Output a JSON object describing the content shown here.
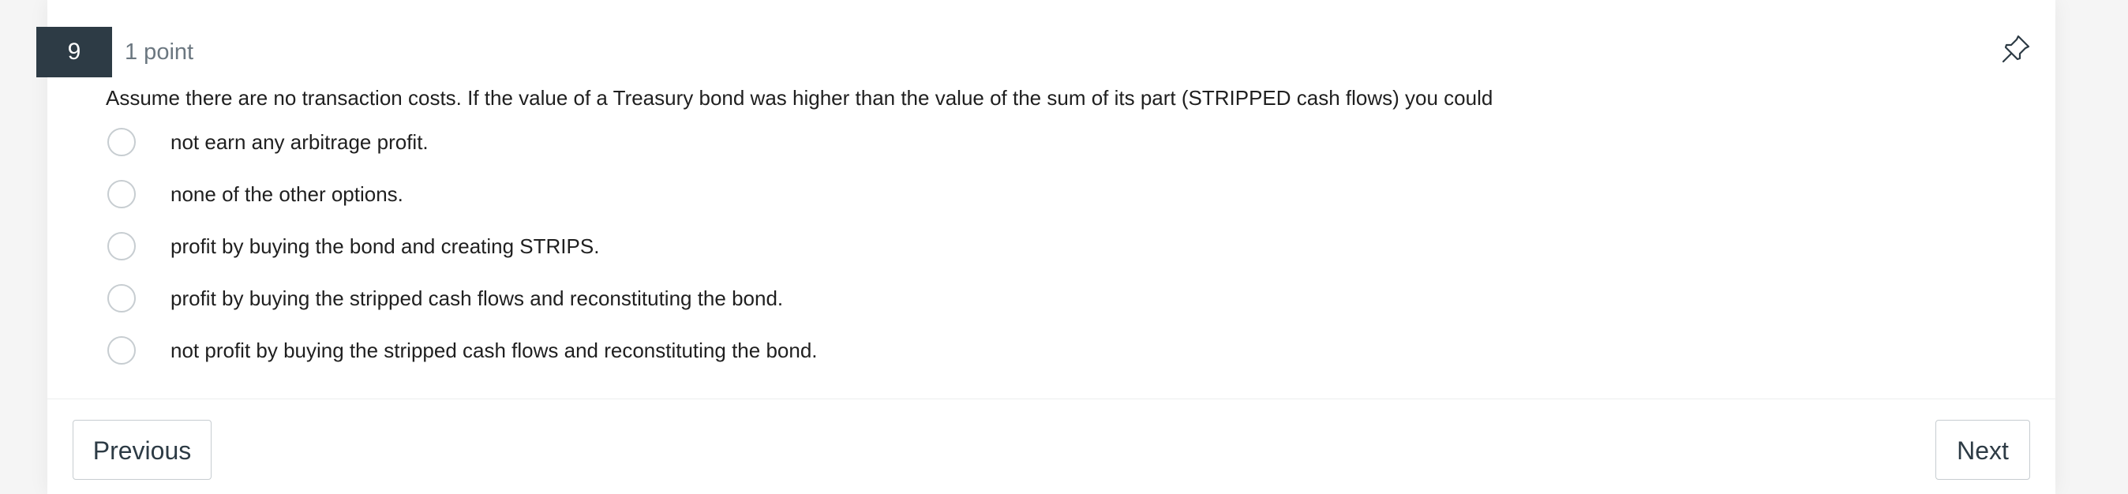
{
  "question": {
    "number": "9",
    "points": "1 point",
    "text": "Assume there are no transaction costs. If the value of a Treasury bond was higher than the value of the sum of its part (STRIPPED cash flows) you could",
    "options": [
      "not earn any arbitrage profit.",
      "none of the other options.",
      "profit by buying the bond and creating STRIPS.",
      "profit by buying the stripped cash flows and reconstituting the bond.",
      "not profit by buying the stripped cash flows and reconstituting the bond."
    ]
  },
  "nav": {
    "previous_label": "Previous",
    "next_label": "Next"
  },
  "icons": {
    "pin": "pin-icon"
  },
  "colors": {
    "question_number_bg": "#2d3b45",
    "border": "#c7cdd1"
  }
}
